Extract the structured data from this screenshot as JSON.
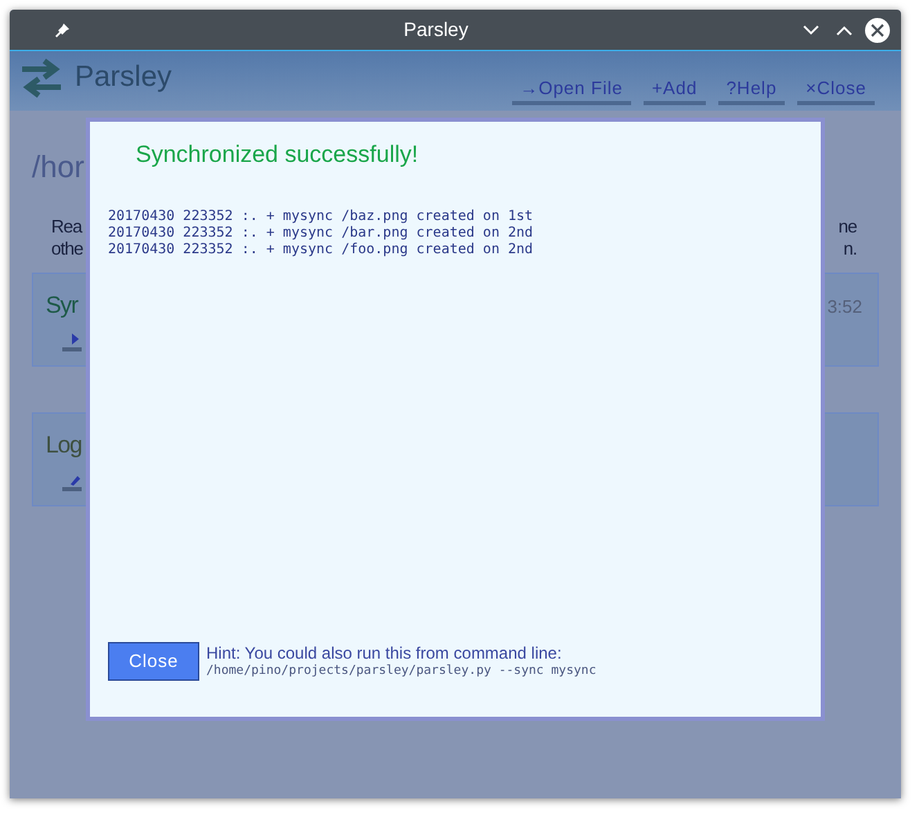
{
  "window": {
    "title": "Parsley"
  },
  "header": {
    "title": "Parsley",
    "buttons": [
      "→Open File",
      "+Add",
      "?Help",
      "×Close"
    ]
  },
  "background": {
    "path": "/hor",
    "description_left": [
      "Rea",
      "othe"
    ],
    "description_right": [
      "ne",
      "n."
    ],
    "cards": [
      {
        "title": "Syr",
        "right": "3:52",
        "kind": "play"
      },
      {
        "title": "Log",
        "kind": "edit"
      }
    ]
  },
  "dialog": {
    "title": "Synchronized successfully!",
    "log": [
      "20170430 223352 :. + mysync /baz.png created on 1st",
      "20170430 223352 :. + mysync /bar.png created on 2nd",
      "20170430 223352 :. + mysync /foo.png created on 2nd"
    ],
    "close_button": "Close",
    "hint": "Hint: You could also run this from command line:",
    "command": "/home/pino/projects/parsley/parsley.py --sync mysync"
  }
}
